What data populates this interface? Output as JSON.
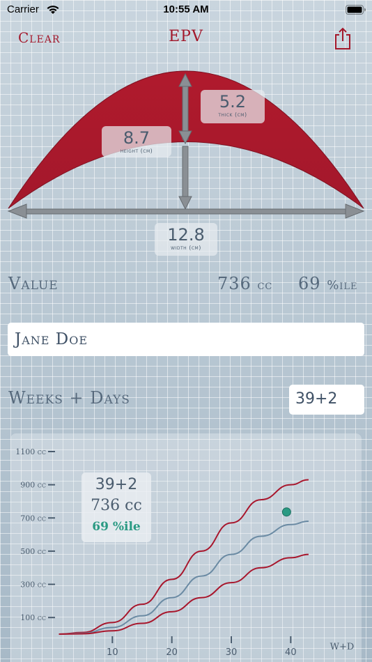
{
  "status_bar": {
    "carrier": "Carrier",
    "time": "10:55 AM"
  },
  "nav": {
    "clear_label": "Clear",
    "title": "EPV",
    "share_icon": "share-icon"
  },
  "diagram": {
    "thick": {
      "value": "5.2",
      "label": "thick (cm)"
    },
    "height": {
      "value": "8.7",
      "label": "height (cm)"
    },
    "width": {
      "value": "12.8",
      "label": "width (cm)"
    }
  },
  "value_row": {
    "label": "Value",
    "cc": "736",
    "cc_unit": "cc",
    "pct": "69",
    "pct_unit": "%ile"
  },
  "patient": {
    "name": "Jane Doe"
  },
  "weeks_row": {
    "label": "Weeks + Days",
    "value": "39+2"
  },
  "readout": {
    "wd": "39+2",
    "cc": "736 cc",
    "pct": "69 %ile"
  },
  "colors": {
    "accent": "#a3182b",
    "curve": "#a8162c",
    "median": "#6a8aa3",
    "point": "#2a9a83"
  },
  "chart_data": {
    "type": "line",
    "xlabel": "W+D",
    "ylabel": "",
    "x_ticks": [
      10,
      20,
      30,
      40
    ],
    "y_ticks": [
      100,
      300,
      500,
      700,
      900,
      1100
    ],
    "y_tick_labels": [
      "100 cc",
      "300 cc",
      "500 cc",
      "700 cc",
      "900 cc",
      "1100 cc"
    ],
    "xlim": [
      0,
      45
    ],
    "ylim": [
      0,
      1100
    ],
    "series": [
      {
        "x": [
          1,
          5,
          10,
          15,
          20,
          25,
          30,
          35,
          40,
          43
        ],
        "y": [
          0,
          10,
          70,
          180,
          330,
          500,
          670,
          810,
          900,
          930
        ]
      },
      {
        "x": [
          1,
          5,
          10,
          15,
          20,
          25,
          30,
          35,
          40,
          43
        ],
        "y": [
          0,
          5,
          40,
          110,
          220,
          350,
          480,
          590,
          660,
          680
        ]
      },
      {
        "x": [
          1,
          5,
          10,
          15,
          20,
          25,
          30,
          35,
          40,
          43
        ],
        "y": [
          0,
          2,
          20,
          65,
          135,
          220,
          310,
          400,
          460,
          480
        ]
      }
    ],
    "points": [
      {
        "x": 39.3,
        "y": 736
      }
    ],
    "grid": true
  }
}
